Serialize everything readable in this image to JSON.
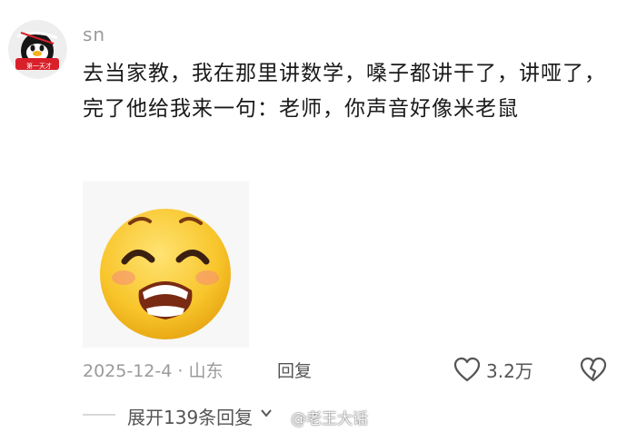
{
  "comment": {
    "avatar_caption": "第一天才",
    "username": "sn",
    "text": "去当家教，我在那里讲数学，嗓子都讲干了，讲哑了，完了他给我来一句：老师，你声音好像米老鼠",
    "sticker": "laughing-crying-face-emoji",
    "date_location": "2025-12-4 · 山东",
    "reply_label": "回复",
    "like_count": "3.2万"
  },
  "replies": {
    "expand_label": "展开139条回复"
  },
  "watermark": {
    "text": "@老王大话"
  },
  "colors": {
    "secondary_text": "#9a9a9a",
    "primary_text": "#1a1a1a",
    "emoji_yellow": "#f8c52b",
    "avatar_red": "#d8202a"
  }
}
